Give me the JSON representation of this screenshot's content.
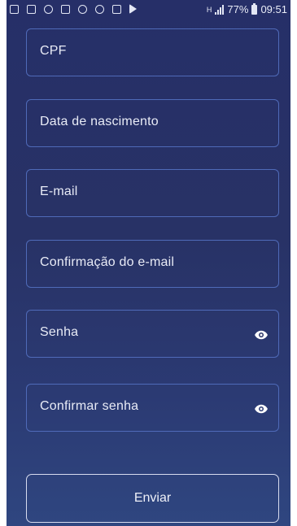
{
  "status_bar": {
    "network": "H",
    "battery_percent": "77%",
    "time": "09:51",
    "left_icons": [
      "notification-icon",
      "gallery-icon",
      "message-icon",
      "image-icon",
      "scissors-icon",
      "voicemail-icon",
      "mail-icon",
      "play-store-icon"
    ]
  },
  "form": {
    "fields": [
      {
        "label": "CPF"
      },
      {
        "label": "Data de nascimento"
      },
      {
        "label": "E-mail"
      },
      {
        "label": "Confirmação do e-mail"
      },
      {
        "label": "Senha",
        "icon": "eye-icon"
      },
      {
        "label": "Confirmar senha",
        "icon": "eye-icon"
      }
    ],
    "submit_label": "Enviar"
  },
  "colors": {
    "background_top": "#262f68",
    "background_bottom": "#2f4680",
    "field_border": "#4f6ab8",
    "text": "#e8ebf6"
  }
}
